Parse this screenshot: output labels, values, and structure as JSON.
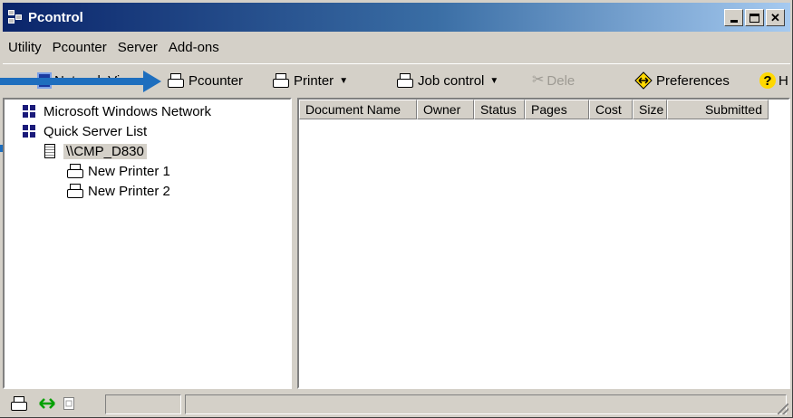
{
  "window": {
    "title": "Pcontrol"
  },
  "menubar": {
    "items": [
      "Utility",
      "Pcounter",
      "Server",
      "Add-ons"
    ]
  },
  "toolbar": {
    "network_view": "Network View",
    "pcounter": "Pcounter",
    "printer": "Printer",
    "job_control": "Job control",
    "delete": "Dele",
    "preferences": "Preferences",
    "help": "H"
  },
  "tree": {
    "items": [
      {
        "label": "Microsoft Windows Network"
      },
      {
        "label": "Quick Server List"
      },
      {
        "label": "\\\\CMP_D830"
      },
      {
        "label": "New Printer 1"
      },
      {
        "label": "New Printer 2"
      }
    ]
  },
  "list": {
    "columns": [
      "Document Name",
      "Owner",
      "Status",
      "Pages",
      "Cost",
      "Size",
      "Submitted"
    ]
  },
  "colors": {
    "accent": "#1e6ebe",
    "titlebar": "#0a246a"
  }
}
